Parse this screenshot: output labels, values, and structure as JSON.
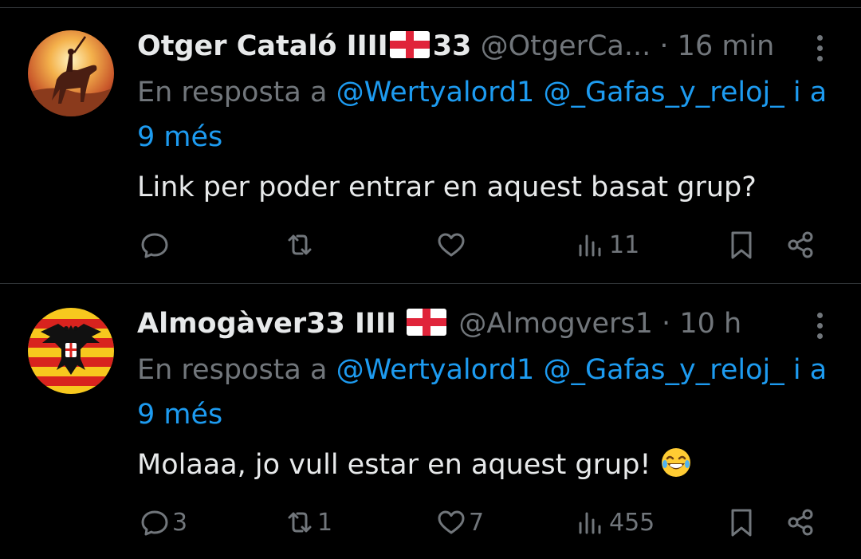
{
  "tweets": [
    {
      "name": "Otger Cataló IIII",
      "name_suffix": "33",
      "handle": "@OtgerCa...",
      "separator": "·",
      "time": "16 min",
      "reply_prefix": "En resposta a",
      "mention_1": "@Wertyalord1",
      "mention_2": "@_Gafas_y_reloj_",
      "reply_joiner": "i",
      "reply_more": "a 9 més",
      "text": "Link per poder entrar en aquest basat grup?",
      "emoji": "",
      "replies": "",
      "retweets": "",
      "likes": "",
      "views": "11",
      "avatar": "horse-rider-icon"
    },
    {
      "name": "Almogàver33 IIII",
      "name_suffix": "",
      "handle": "@Almogvers1",
      "separator": "·",
      "time": "10 h",
      "reply_prefix": "En resposta a",
      "mention_1": "@Wertyalord1",
      "mention_2": "@_Gafas_y_reloj_",
      "reply_joiner": "i",
      "reply_more": "a 9 més",
      "text": "Molaaa, jo vull estar en aquest grup!",
      "emoji": "joy-emoji",
      "replies": "3",
      "retweets": "1",
      "likes": "7",
      "views": "455",
      "avatar": "eagle-flag-icon"
    }
  ],
  "icons": {
    "reply": "speech-bubble-icon",
    "retweet": "retweet-icon",
    "like": "heart-icon",
    "views": "bar-chart-icon",
    "bookmark": "bookmark-icon",
    "share": "share-icon",
    "more": "more-vertical-icon",
    "flag": "st-george-cross-flag"
  },
  "colors": {
    "background": "#000000",
    "text": "#e7e9ea",
    "muted": "#71767b",
    "link": "#1d9bf0",
    "divider": "#2f3336"
  }
}
